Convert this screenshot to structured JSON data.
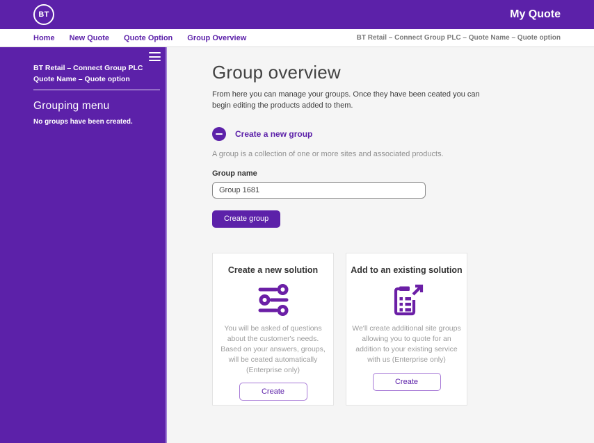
{
  "brand": {
    "logo_text": "BT",
    "title": "My Quote"
  },
  "colors": {
    "purple": "#5c21a9",
    "light_purple_border": "#a678d6",
    "main_bg": "#f5f5f5",
    "gray_text": "#9c9c9c"
  },
  "icons": {
    "logo": "bt-logo",
    "menu": "hamburger-icon",
    "toggle": "minus-circle-icon",
    "card1": "sliders-icon",
    "card2": "clipboard-arrow-icon"
  },
  "nav": {
    "items": [
      "Home",
      "New Quote",
      "Quote Option",
      "Group Overview"
    ],
    "breadcrumb": "BT Retail – Connect Group PLC – Quote Name – Quote option"
  },
  "sidebar": {
    "account_line1": "BT Retail – Connect Group PLC",
    "account_line2": "Quote Name – Quote option",
    "menu_title": "Grouping menu",
    "empty_message": "No groups have been created."
  },
  "main": {
    "title": "Group overview",
    "intro": "From here you can manage your groups. Once they have been ceated you can begin editing the products added to them.",
    "create_group": {
      "toggle_label": "Create a new group",
      "description": "A group is a collection of one or more sites and associated products.",
      "name_label": "Group name",
      "name_value": "Group 1681",
      "submit_label": "Create group"
    },
    "cards": [
      {
        "title": "Create a new solution",
        "icon": "sliders-icon",
        "description": "You will be asked of questions about the customer's needs. Based on your answers, groups, will be ceated automatically (Enterprise only)",
        "button_label": "Create"
      },
      {
        "title": "Add to an existing solution",
        "icon": "clipboard-arrow-icon",
        "description": "We'll create additional site groups allowing you to quote for an addition to your existing service with us (Enterprise only)",
        "button_label": "Create"
      }
    ]
  }
}
